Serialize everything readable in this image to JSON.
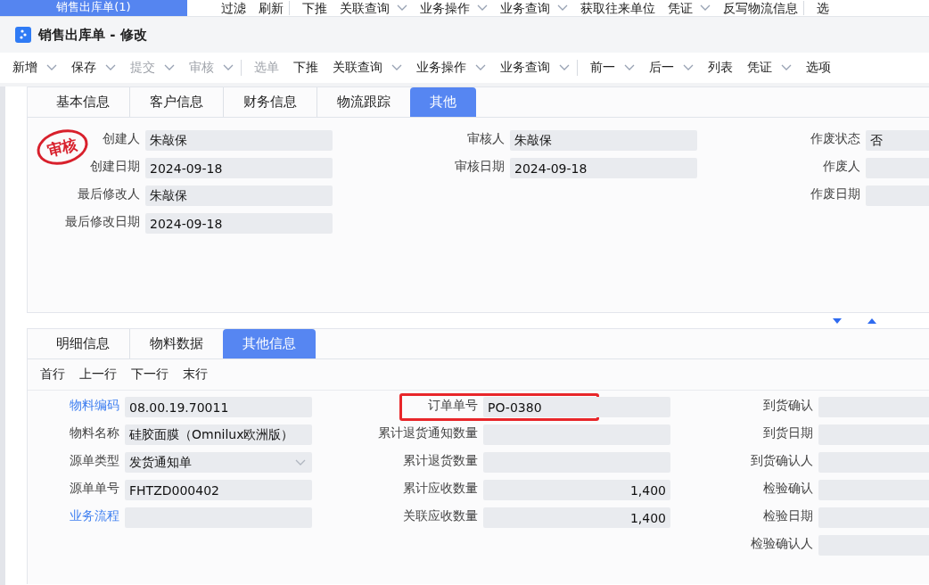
{
  "top_bar": {
    "doc_tab": {
      "label": "销售出库单(1)",
      "selected": true
    },
    "items": [
      {
        "label": "过滤",
        "dropdown": false,
        "group_end": false
      },
      {
        "label": "刷新",
        "dropdown": false,
        "group_end": true
      },
      {
        "label": "下推",
        "dropdown": false,
        "group_end": false
      },
      {
        "label": "关联查询",
        "dropdown": true,
        "group_end": false
      },
      {
        "label": "业务操作",
        "dropdown": true,
        "group_end": false
      },
      {
        "label": "业务查询",
        "dropdown": true,
        "group_end": false
      },
      {
        "label": "获取往来单位",
        "dropdown": false,
        "group_end": false
      },
      {
        "label": "凭证",
        "dropdown": true,
        "group_end": false
      },
      {
        "label": "反写物流信息",
        "dropdown": false,
        "group_end": true
      },
      {
        "label": "选",
        "dropdown": false,
        "group_end": false
      }
    ]
  },
  "window": {
    "title": "销售出库单 - 修改"
  },
  "toolbar": [
    {
      "label": "新增",
      "dropdown": true,
      "disabled": false,
      "group_end": false
    },
    {
      "label": "保存",
      "dropdown": true,
      "disabled": false,
      "group_end": false
    },
    {
      "label": "提交",
      "dropdown": true,
      "disabled": true,
      "group_end": false
    },
    {
      "label": "审核",
      "dropdown": true,
      "disabled": true,
      "group_end": true
    },
    {
      "label": "选单",
      "dropdown": false,
      "disabled": true,
      "group_end": false
    },
    {
      "label": "下推",
      "dropdown": false,
      "disabled": false,
      "group_end": false
    },
    {
      "label": "关联查询",
      "dropdown": true,
      "disabled": false,
      "group_end": false
    },
    {
      "label": "业务操作",
      "dropdown": true,
      "disabled": false,
      "group_end": false
    },
    {
      "label": "业务查询",
      "dropdown": true,
      "disabled": false,
      "group_end": true
    },
    {
      "label": "前一",
      "dropdown": true,
      "disabled": false,
      "group_end": false
    },
    {
      "label": "后一",
      "dropdown": true,
      "disabled": false,
      "group_end": false
    },
    {
      "label": "列表",
      "dropdown": false,
      "disabled": false,
      "group_end": false
    },
    {
      "label": "凭证",
      "dropdown": true,
      "disabled": false,
      "group_end": false
    },
    {
      "label": "选项",
      "dropdown": false,
      "disabled": false,
      "group_end": false
    }
  ],
  "header_panel": {
    "tabs": [
      {
        "label": "基本信息",
        "selected": false
      },
      {
        "label": "客户信息",
        "selected": false
      },
      {
        "label": "财务信息",
        "selected": false
      },
      {
        "label": "物流跟踪",
        "selected": false
      },
      {
        "label": "其他",
        "selected": true
      }
    ],
    "stamp": "审核",
    "columns": [
      [
        {
          "label": "创建人",
          "value": "朱敲保"
        },
        {
          "label": "创建日期",
          "value": "2024-09-18"
        },
        {
          "label": "最后修改人",
          "value": "朱敲保"
        },
        {
          "label": "最后修改日期",
          "value": "2024-09-18"
        }
      ],
      [
        {
          "label": "审核人",
          "value": "朱敲保"
        },
        {
          "label": "审核日期",
          "value": "2024-09-18"
        }
      ],
      [
        {
          "label": "作废状态",
          "value": "否"
        },
        {
          "label": "作废人"
        },
        {
          "label": "作废日期"
        }
      ]
    ]
  },
  "detail_panel": {
    "tabs": [
      {
        "label": "明细信息",
        "selected": false
      },
      {
        "label": "物料数据",
        "selected": false
      },
      {
        "label": "其他信息",
        "selected": true
      }
    ],
    "row_nav": [
      "首行",
      "上一行",
      "下一行",
      "末行"
    ],
    "columns": [
      [
        {
          "label": "物料编码",
          "link": true,
          "kind": "text",
          "value": "08.00.19.70011",
          "highlighted": false
        },
        {
          "label": "物料名称",
          "link": false,
          "kind": "text",
          "value": "硅胶面膜（Omnilux欧洲版）",
          "highlighted": false
        },
        {
          "label": "源单类型",
          "link": false,
          "kind": "select",
          "value": "发货通知单",
          "highlighted": false
        },
        {
          "label": "源单单号",
          "link": false,
          "kind": "text",
          "value": "FHTZD000402",
          "highlighted": false
        },
        {
          "label": "业务流程",
          "link": true,
          "kind": "text",
          "highlighted": false
        }
      ],
      [
        {
          "label": "订单单号",
          "link": false,
          "kind": "text",
          "value": "PO-0380",
          "highlighted": true
        },
        {
          "label": "累计退货通知数量",
          "link": false,
          "kind": "number",
          "highlighted": false
        },
        {
          "label": "累计退货数量",
          "link": false,
          "kind": "number",
          "highlighted": false
        },
        {
          "label": "累计应收数量",
          "link": false,
          "kind": "number",
          "value": "1,400",
          "highlighted": false
        },
        {
          "label": "关联应收数量",
          "link": false,
          "kind": "number",
          "value": "1,400",
          "highlighted": false
        }
      ],
      [
        {
          "label": "到货确认",
          "link": false,
          "kind": "text",
          "highlighted": false
        },
        {
          "label": "到货日期",
          "link": false,
          "kind": "text",
          "highlighted": false
        },
        {
          "label": "到货确认人",
          "link": false,
          "kind": "text",
          "highlighted": false
        },
        {
          "label": "检验确认",
          "link": false,
          "kind": "text",
          "highlighted": false
        },
        {
          "label": "检验日期",
          "link": false,
          "kind": "text",
          "highlighted": false
        },
        {
          "label": "检验确认人",
          "link": false,
          "kind": "text",
          "highlighted": false
        }
      ]
    ]
  }
}
